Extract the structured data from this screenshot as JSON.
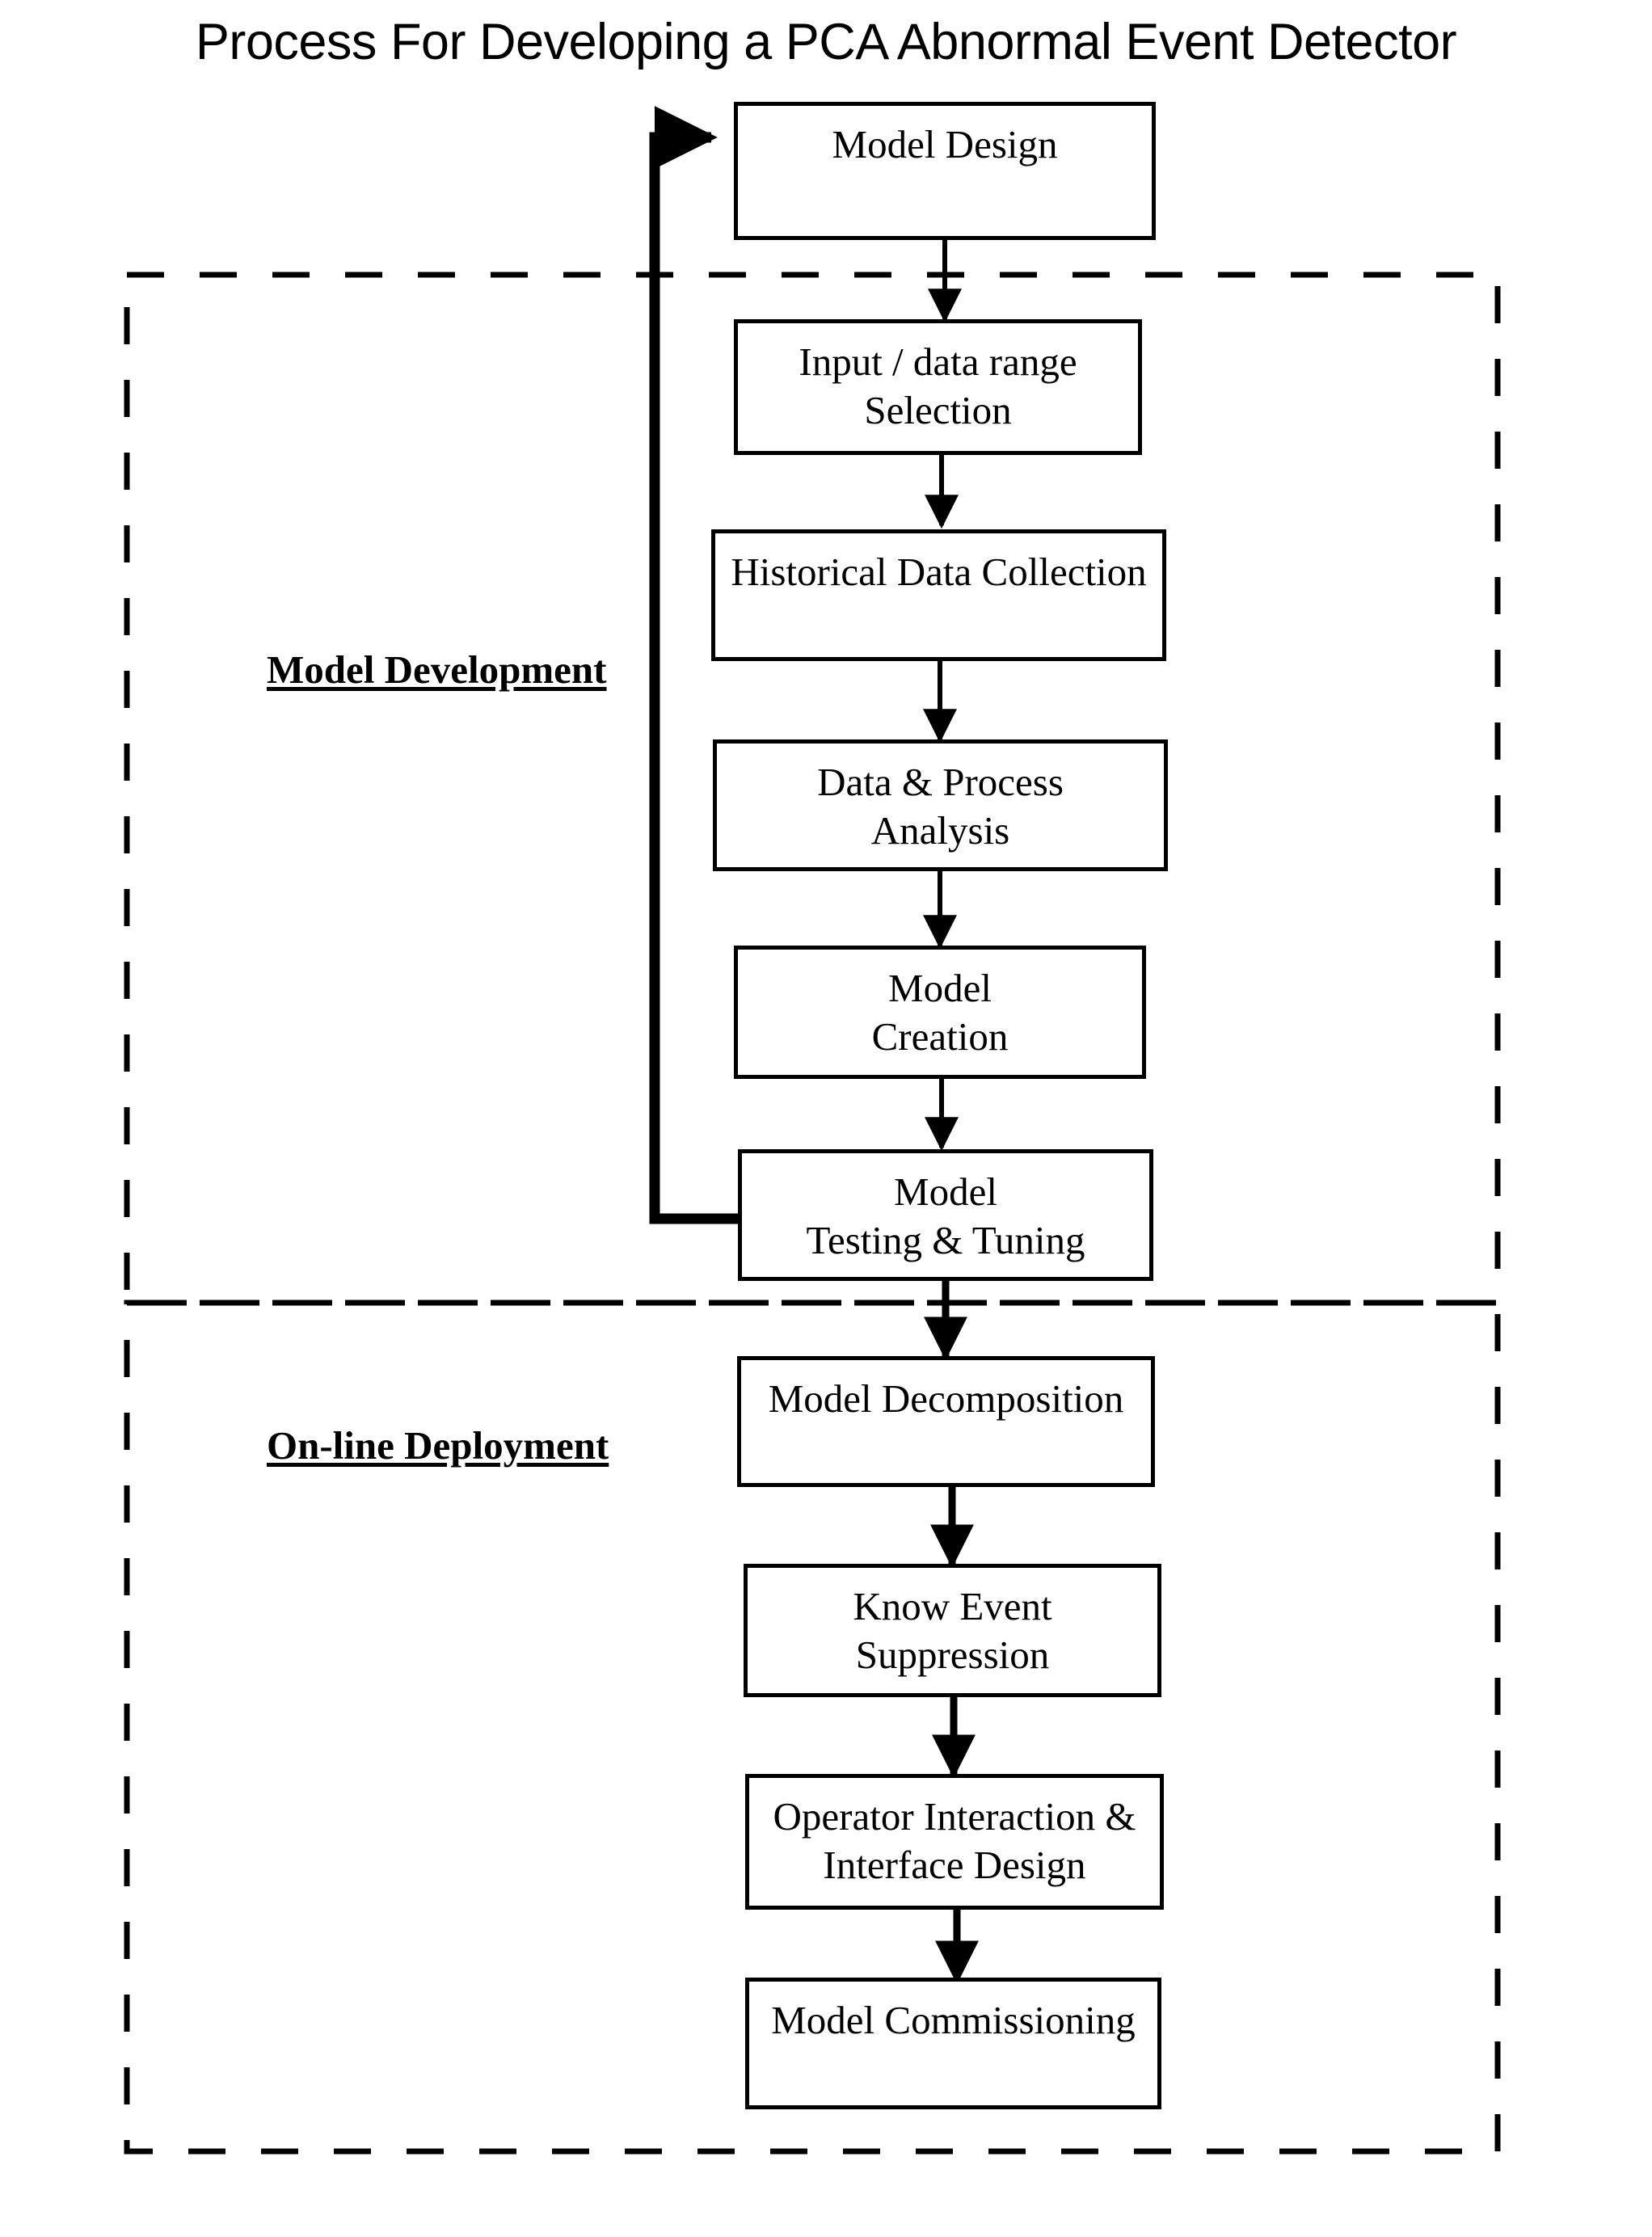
{
  "title": "Process For Developing a PCA Abnormal Event Detector",
  "groups": [
    {
      "label": "Model Development"
    },
    {
      "label": "On-line Deployment"
    }
  ],
  "boxes": [
    {
      "id": "model-design",
      "lines": [
        "Model Design"
      ]
    },
    {
      "id": "input-data-range",
      "lines": [
        "Input / data range",
        "Selection"
      ]
    },
    {
      "id": "historical-data",
      "lines": [
        "Historical Data Collection"
      ]
    },
    {
      "id": "data-process-analysis",
      "lines": [
        "Data & Process",
        "Analysis"
      ]
    },
    {
      "id": "model-creation",
      "lines": [
        "Model",
        "Creation"
      ]
    },
    {
      "id": "model-testing-tuning",
      "lines": [
        "Model",
        "Testing & Tuning"
      ]
    },
    {
      "id": "model-decomposition",
      "lines": [
        "Model Decomposition"
      ]
    },
    {
      "id": "know-event-suppression",
      "lines": [
        "Know Event",
        "Suppression"
      ]
    },
    {
      "id": "operator-interaction",
      "lines": [
        "Operator Interaction &",
        "Interface Design"
      ]
    },
    {
      "id": "model-commissioning",
      "lines": [
        "Model Commissioning"
      ]
    }
  ],
  "chart_data": {
    "type": "diagram",
    "title": "Process For Developing a PCA Abnormal Event Detector",
    "nodes": [
      "Model Design",
      "Input / data range Selection",
      "Historical Data Collection",
      "Data & Process Analysis",
      "Model Creation",
      "Model Testing & Tuning",
      "Model Decomposition",
      "Know Event Suppression",
      "Operator Interaction & Interface Design",
      "Model Commissioning"
    ],
    "edges": [
      [
        "Model Design",
        "Input / data range Selection"
      ],
      [
        "Input / data range Selection",
        "Historical Data Collection"
      ],
      [
        "Historical Data Collection",
        "Data & Process Analysis"
      ],
      [
        "Data & Process Analysis",
        "Model Creation"
      ],
      [
        "Model Creation",
        "Model Testing & Tuning"
      ],
      [
        "Model Testing & Tuning",
        "Model Design"
      ],
      [
        "Model Testing & Tuning",
        "Model Decomposition"
      ],
      [
        "Model Decomposition",
        "Know Event Suppression"
      ],
      [
        "Know Event Suppression",
        "Operator Interaction & Interface Design"
      ],
      [
        "Operator Interaction & Interface Design",
        "Model Commissioning"
      ]
    ],
    "groups": [
      {
        "label": "Model Development",
        "members": [
          "Input / data range Selection",
          "Historical Data Collection",
          "Data & Process Analysis",
          "Model Creation",
          "Model Testing & Tuning"
        ]
      },
      {
        "label": "On-line Deployment",
        "members": [
          "Model Decomposition",
          "Know Event Suppression",
          "Operator Interaction & Interface Design",
          "Model Commissioning"
        ]
      }
    ],
    "colors": {
      "stroke": "#000000",
      "fill": "#ffffff",
      "text": "#000000"
    }
  }
}
